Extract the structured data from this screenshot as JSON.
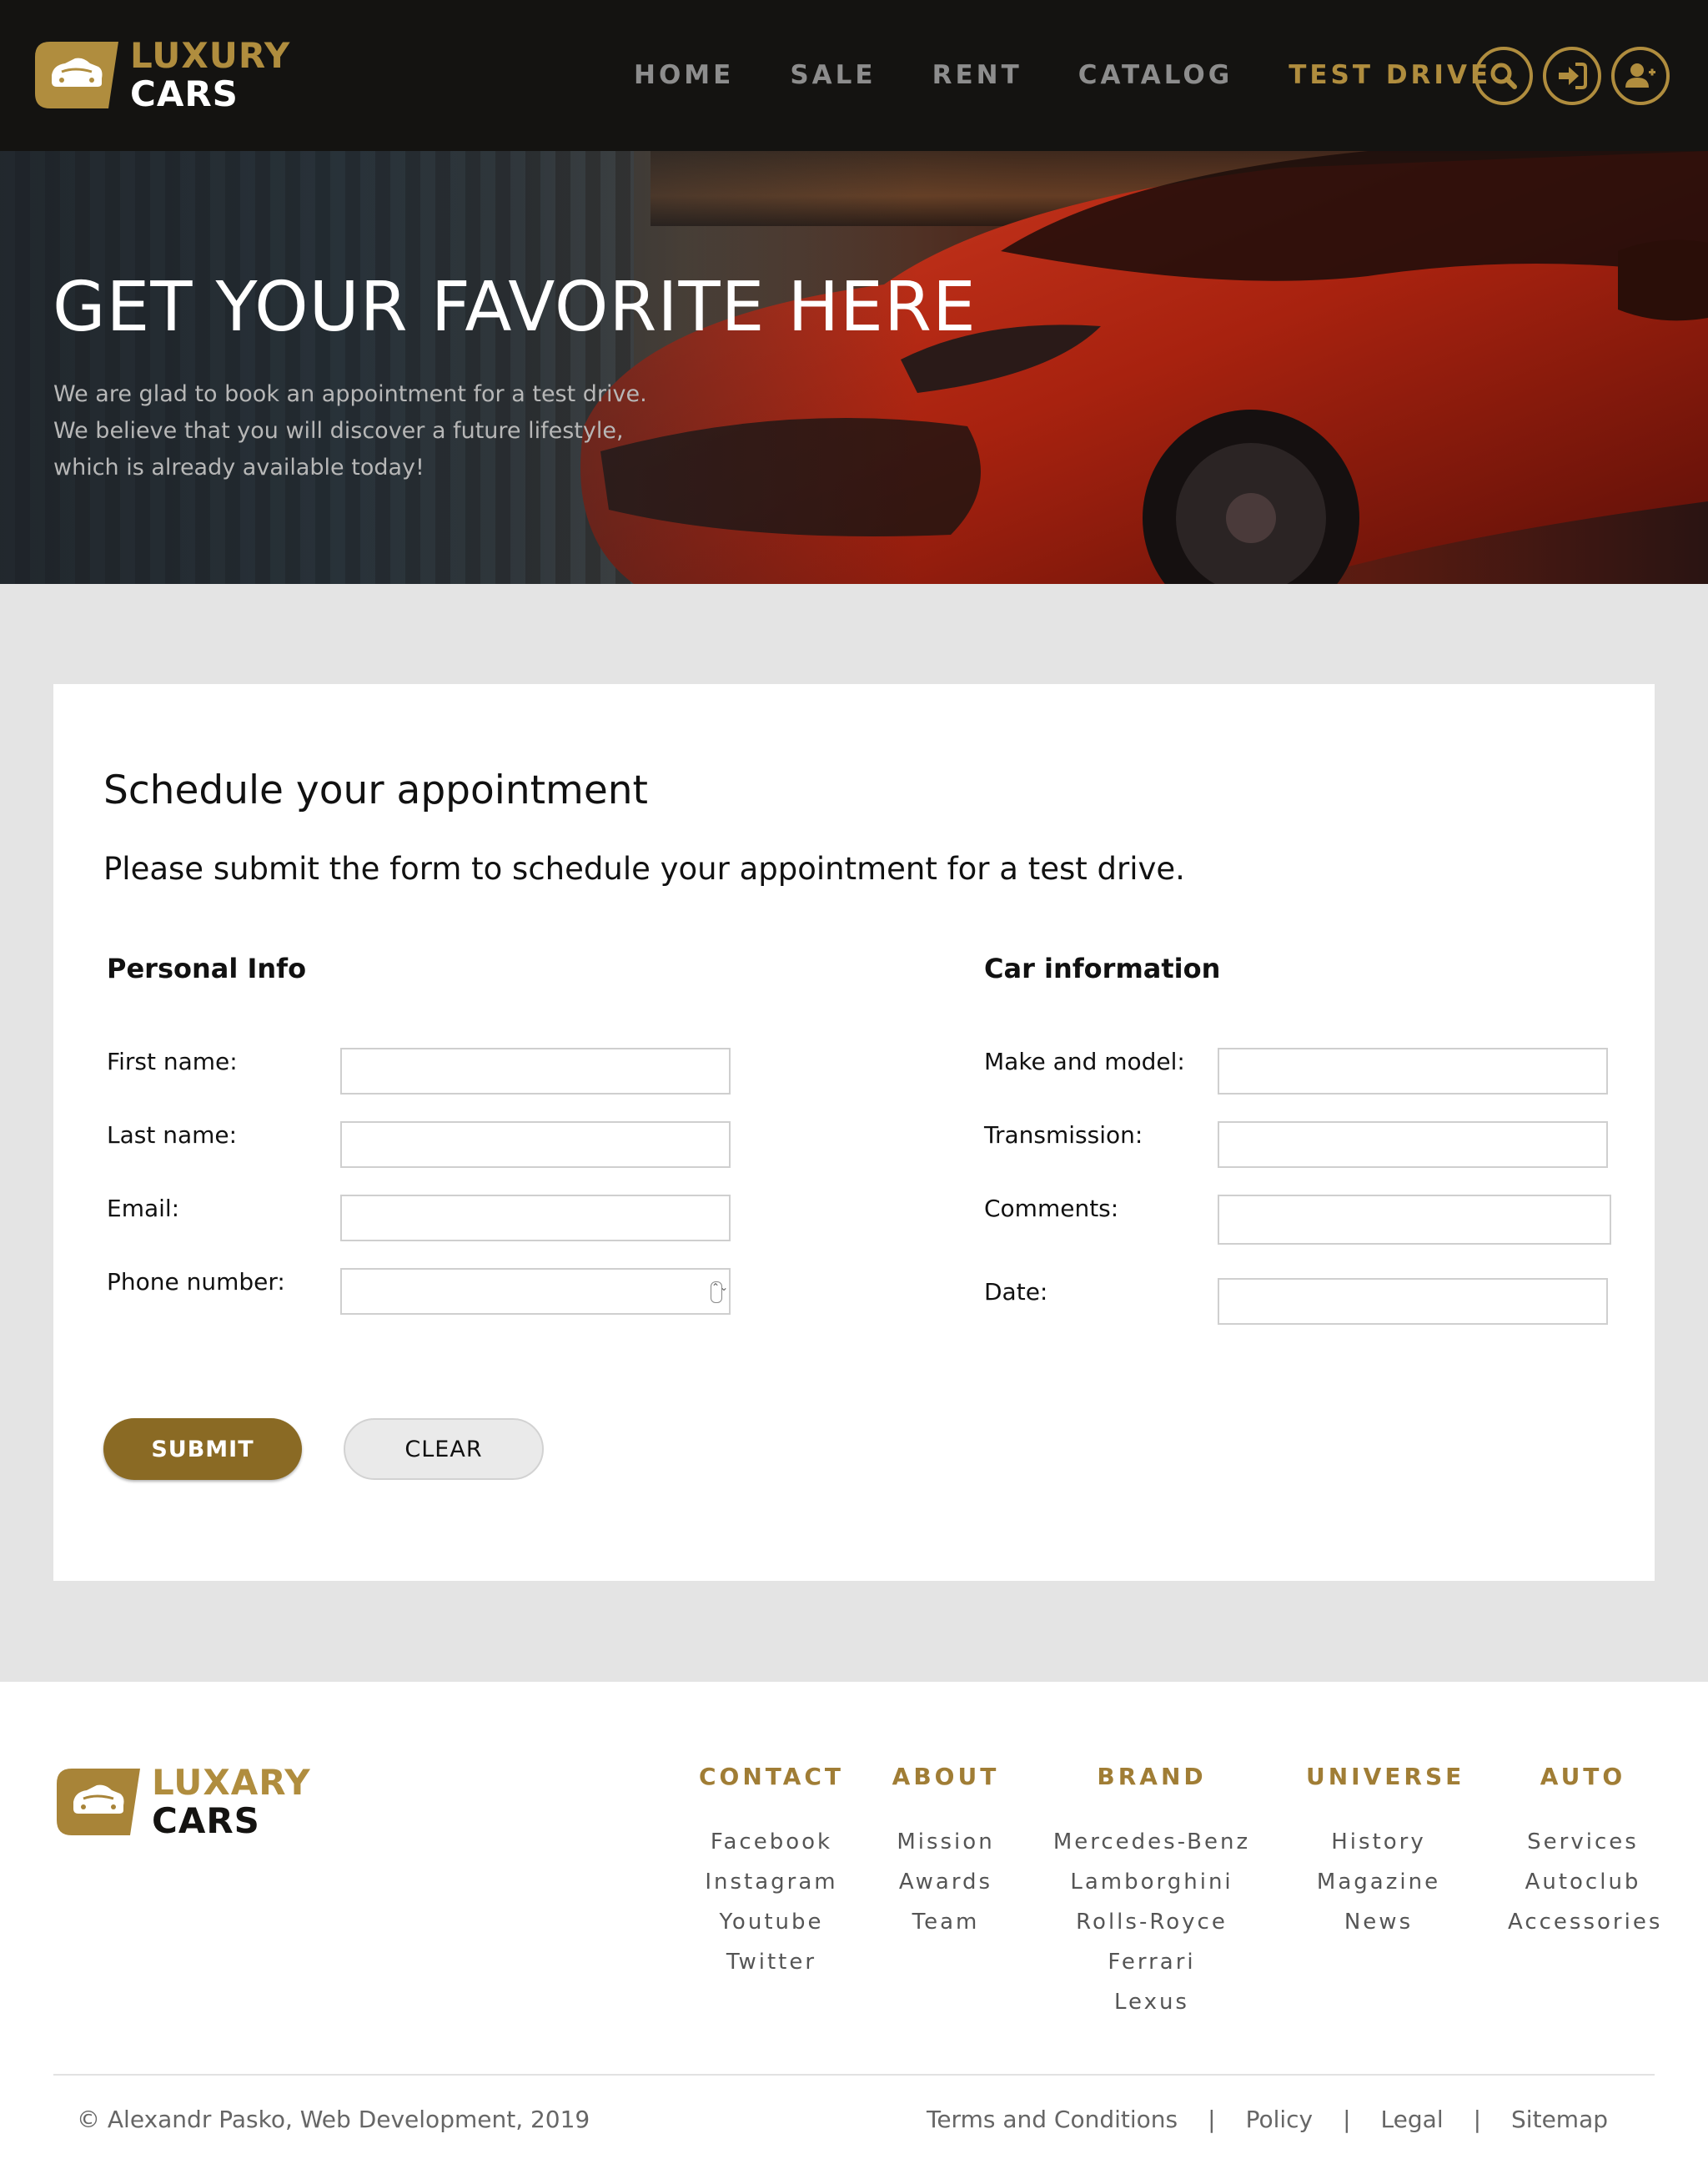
{
  "brand": {
    "line1": "LUXURY",
    "line2": "CARS",
    "accent_color": "#b08d3e",
    "header_bg": "#141311"
  },
  "nav": {
    "items": [
      {
        "label": "HOME",
        "active": false
      },
      {
        "label": "SALE",
        "active": false
      },
      {
        "label": "RENT",
        "active": false
      },
      {
        "label": "CATALOG",
        "active": false
      },
      {
        "label": "TEST DRIVE",
        "active": true
      }
    ],
    "icons": [
      "search-icon",
      "sign-in-icon",
      "add-user-icon"
    ]
  },
  "hero": {
    "title": "GET YOUR FAVORITE HERE",
    "lines": [
      "We are glad to book an appointment for a test drive.",
      "We believe that you will discover a future lifestyle,",
      "which is already available today!"
    ]
  },
  "form": {
    "title": "Schedule your appointment",
    "subtitle": "Please submit the form to schedule your appointment for a test drive.",
    "personal": {
      "heading": "Personal Info",
      "fields": [
        {
          "label": "First name:",
          "value": ""
        },
        {
          "label": "Last name:",
          "value": ""
        },
        {
          "label": "Email:",
          "value": ""
        },
        {
          "label": "Phone number:",
          "value": ""
        }
      ]
    },
    "car": {
      "heading": "Car information",
      "fields": [
        {
          "label": "Make and model:",
          "value": ""
        },
        {
          "label": "Transmission:",
          "value": ""
        },
        {
          "label": "Comments:",
          "value": ""
        },
        {
          "label": "Date:",
          "value": ""
        }
      ]
    },
    "submit_label": "SUBMIT",
    "clear_label": "CLEAR",
    "submit_color": "#8a6a24"
  },
  "footer": {
    "brand_line1": "LUXARY",
    "brand_line2": "CARS",
    "columns": [
      {
        "heading": "CONTACT",
        "links": [
          "Facebook",
          "Instagram",
          "Youtube",
          "Twitter"
        ]
      },
      {
        "heading": "ABOUT",
        "links": [
          "Mission",
          "Awards",
          "Team"
        ]
      },
      {
        "heading": "BRAND",
        "links": [
          "Mercedes-Benz",
          "Lamborghini",
          "Rolls-Royce",
          "Ferrari",
          "Lexus"
        ]
      },
      {
        "heading": "UNIVERSE",
        "links": [
          "History",
          "Magazine",
          "News"
        ]
      },
      {
        "heading": "AUTO",
        "links": [
          "Services",
          "Autoclub",
          "Accessories"
        ]
      }
    ],
    "copyright": "© Alexandr Pasko, Web Development, 2019",
    "legal": [
      "Terms and Conditions",
      "Policy",
      "Legal",
      "Sitemap"
    ],
    "separator": "|"
  }
}
